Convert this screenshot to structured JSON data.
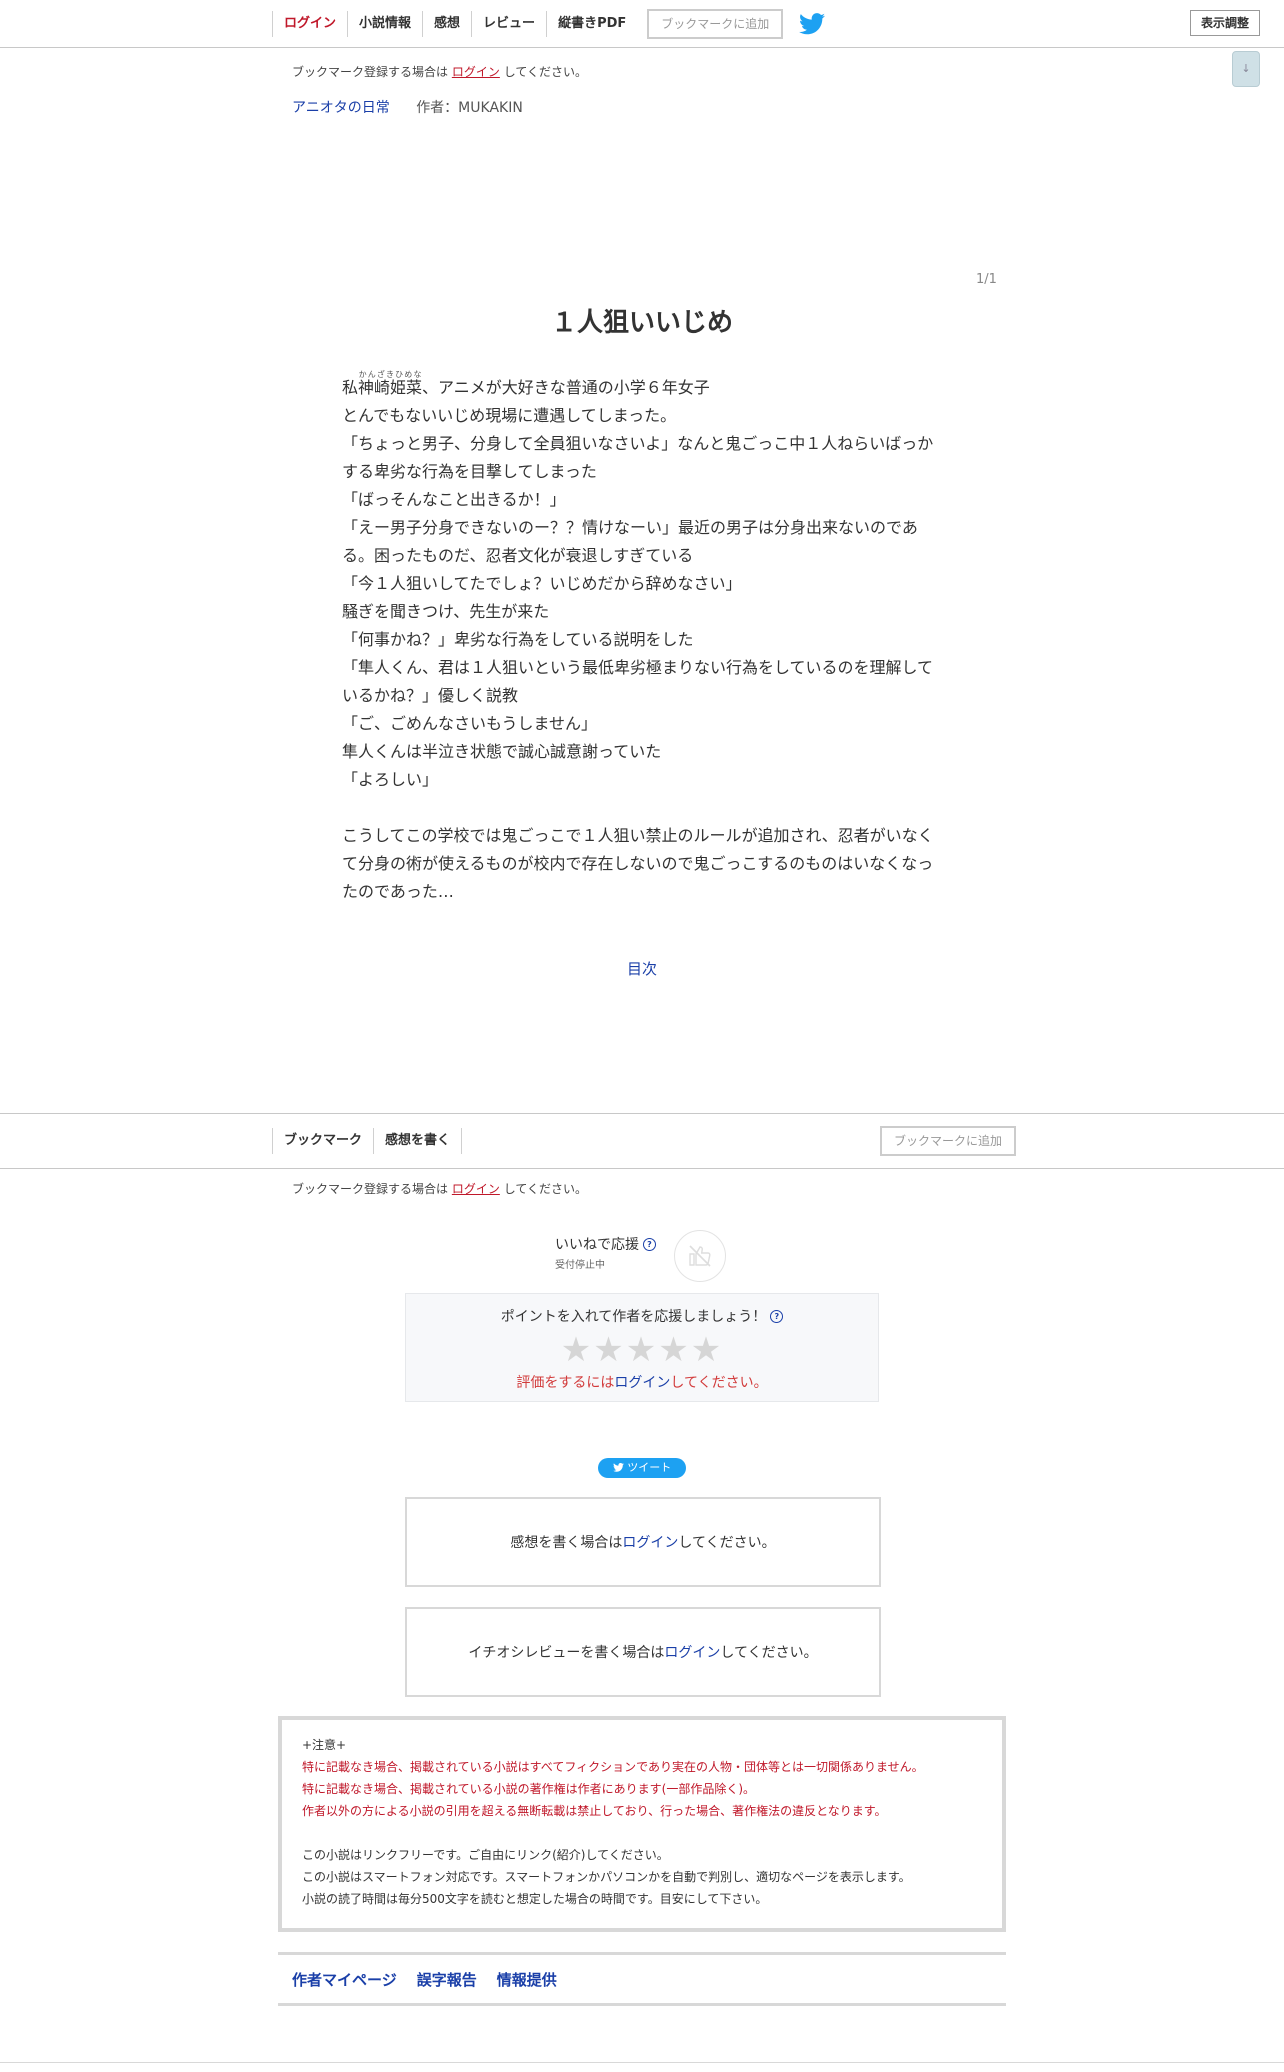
{
  "topnav": {
    "login": "ログイン",
    "novel_info": "小説情報",
    "impressions": "感想",
    "review": "レビュー",
    "vertical_pdf": "縦書きPDF",
    "add_bookmark": "ブックマークに追加",
    "display_settings": "表示調整",
    "scroll_arrow": "↓"
  },
  "bookmark_notice": {
    "before": "ブックマーク登録する場合は",
    "link": "ログイン",
    "after": "してください。"
  },
  "series": {
    "title": "アニオタの日常",
    "author": "作者：MUKAKIN"
  },
  "chapter": {
    "page": "1/1",
    "title": "１人狙いいじめ",
    "ruby_base": "神崎姫菜",
    "ruby_text": "かんざきひめな",
    "first_line_prefix": "私",
    "first_line_rest": "、アニメが大好きな普通の小学６年女子",
    "lines": [
      "とんでもないいじめ現場に遭遇してしまった。",
      "「ちょっと男子、分身して全員狙いなさいよ」なんと鬼ごっこ中１人ねらいばっかする卑劣な行為を目撃してしまった",
      "「ばっそんなこと出きるか！」",
      "「えー男子分身できないのー？？情けなーい」最近の男子は分身出来ないのである。困ったものだ、忍者文化が衰退しすぎている",
      "「今１人狙いしてたでしょ？いじめだから辞めなさい」",
      "騒ぎを聞きつけ、先生が来た",
      "「何事かね？」卑劣な行為をしている説明をした",
      "「隼人くん、君は１人狙いという最低卑劣極まりない行為をしているのを理解しているかね？」優しく説教",
      "「ご、ごめんなさいもうしません」",
      "隼人くんは半泣き状態で誠心誠意謝っていた",
      "「よろしい」",
      "",
      "こうしてこの学校では鬼ごっこで１人狙い禁止のルールが追加され、忍者がいなくて分身の術が使えるものが校内で存在しないので鬼ごっこするのものはいなくなったのであった…"
    ],
    "toc": "目次"
  },
  "midnav": {
    "bookmark": "ブックマーク",
    "write_impression": "感想を書く",
    "add_bookmark": "ブックマークに追加"
  },
  "iine": {
    "label": "いいねで応援",
    "help": "?",
    "status": "受付停止中"
  },
  "points": {
    "title": "ポイントを入れて作者を応援しましょう！",
    "help": "?",
    "stars": "★★★★★",
    "login_before": "評価をするには",
    "login_link": "ログイン",
    "login_after": "してください。"
  },
  "tweet": {
    "label": "ツイート"
  },
  "impression_box": {
    "before": "感想を書く場合は",
    "link": "ログイン",
    "after": "してください。"
  },
  "review_box": {
    "before": "イチオシレビューを書く場合は",
    "link": "ログイン",
    "after": "してください。"
  },
  "caution": {
    "heading": "+注意+",
    "red_lines": [
      "特に記載なき場合、掲載されている小説はすべてフィクションであり実在の人物・団体等とは一切関係ありません。",
      "特に記載なき場合、掲載されている小説の著作権は作者にあります(一部作品除く)。",
      "作者以外の方による小説の引用を超える無断転載は禁止しており、行った場合、著作権法の違反となります。"
    ],
    "info_lines": [
      "この小説はリンクフリーです。ご自由にリンク(紹介)してください。",
      "この小説はスマートフォン対応です。スマートフォンかパソコンかを自動で判別し、適切なページを表示します。",
      "小説の読了時間は毎分500文字を読むと想定した場合の時間です。目安にして下さい。"
    ]
  },
  "footer": {
    "author_page": "作者マイページ",
    "typo_report": "誤字報告",
    "info": "情報提供"
  },
  "colors": {
    "link": "#1a3fa8",
    "login_red": "#c0182a",
    "twitter": "#1da1f2"
  }
}
